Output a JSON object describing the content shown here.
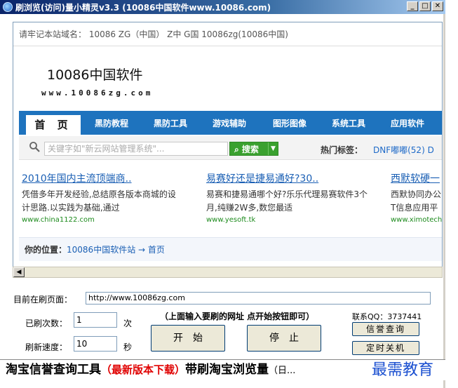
{
  "window": {
    "title": "刷浏览(访问)量小精灵v3.3  (10086中国软件www.10086.com)",
    "buttons": {
      "minimize": "_",
      "maximize": "□",
      "close": "✕"
    }
  },
  "webpage": {
    "notice": "请牢记本站域名： 10086  ZG（中国）  Z中 G国  10086zg(10086中国)",
    "logo": {
      "title": "10086中国软件",
      "subtitle": "www.10086zg.com"
    },
    "nav": [
      "首 页",
      "黑防教程",
      "黑防工具",
      "游戏辅助",
      "图形图像",
      "系统工具",
      "应用软件"
    ],
    "search": {
      "placeholder": "关键字如\"新云网站管理系统\"...",
      "button": "搜索",
      "hot_label": "热门标签：",
      "hot_link": "DNF嘟嘟(52)  D"
    },
    "ads": [
      {
        "title": "2010年国内主流顶端商..",
        "desc1": "凭借多年开发经验,总结原各版本商城的设",
        "desc2": "计思路.以实践为基础,通过",
        "url": "www.china1122.com"
      },
      {
        "title": "易赛好还是捷易通好?30..",
        "desc1": "易赛和捷易通哪个好?乐乐代理易赛软件3个",
        "desc2": "月,纯赚2W多,数您最适",
        "url": "www.yesoft.tk"
      },
      {
        "title": "西默软硬一",
        "desc1": "西默协同办公",
        "desc2": "T信息应用平",
        "url": "www.ximotech"
      }
    ],
    "location": {
      "label": "你的位置：",
      "path": "10086中国软件站 → 首页"
    }
  },
  "form": {
    "current_page_label": "目前在刷页面：",
    "url_value": "http://www.10086zg.com",
    "hint": "（上面输入要刷的网址 点开始按钮即可）",
    "refresh_count_label": "已刷次数：",
    "refresh_count_value": "1",
    "refresh_count_unit": "次",
    "refresh_speed_label": "刷新速度：",
    "refresh_speed_value": "10",
    "refresh_speed_unit": "秒",
    "start_button": "开始",
    "stop_button": "停止",
    "contact": "联系QQ：3737441",
    "credit_button": "信誉查询",
    "shutdown_button": "定时关机"
  },
  "banner": {
    "part1": "淘宝信誉查询工具",
    "part2": "（最新版本下载）",
    "part3": "带刷淘宝浏览量",
    "part4": "（日..."
  },
  "watermark": "最需教育"
}
